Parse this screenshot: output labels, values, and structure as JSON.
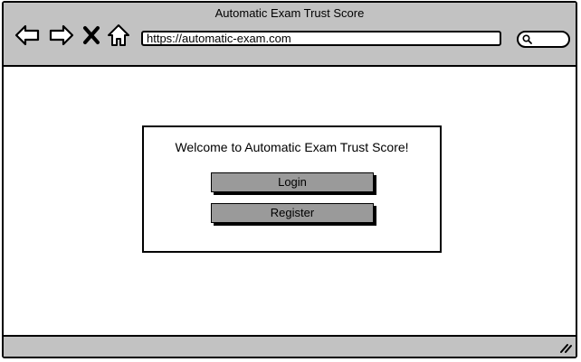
{
  "window": {
    "title": "Automatic Exam Trust Score"
  },
  "toolbar": {
    "back_icon": "arrow-left-icon",
    "forward_icon": "arrow-right-icon",
    "stop_icon": "close-icon",
    "home_icon": "home-icon",
    "search_icon": "search-icon"
  },
  "address_bar": {
    "url": "https://automatic-exam.com"
  },
  "dialog": {
    "title": "Welcome to Automatic Exam Trust Score!",
    "login_label": "Login",
    "register_label": "Register"
  },
  "colors": {
    "chrome": "#c2c2c2",
    "button": "#9a9a9a"
  }
}
